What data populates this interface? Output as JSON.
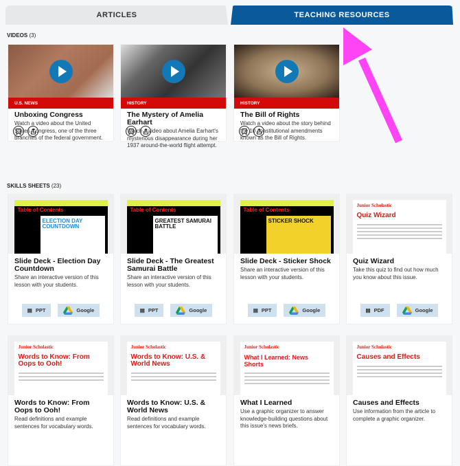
{
  "tabs": [
    {
      "label": "ARTICLES",
      "active": false
    },
    {
      "label": "TEACHING RESOURCES",
      "active": true
    }
  ],
  "videos": {
    "label": "VIDEOS",
    "count": "(3)",
    "items": [
      {
        "tag": "U.S. NEWS",
        "title": "Unboxing Congress",
        "desc": "Watch a video about the United States Congress, one of the three branches of the federal government."
      },
      {
        "tag": "HISTORY",
        "title": "The Mystery of Amelia Earhart",
        "desc": "Watch a video about Amelia Earhart's mysterious disappearance during her 1937 around-the-world flight attempt."
      },
      {
        "tag": "HISTORY",
        "title": "The Bill of Rights",
        "desc": "Watch a video about the story behind the 10 constitutional amendments known as the Bill of Rights."
      }
    ]
  },
  "skills": {
    "label": "SKILLS SHEETS",
    "count": "(23)",
    "items": [
      {
        "title": "Slide Deck - Election Day Countdown",
        "desc": "Share an interactive version of this lesson with your students.",
        "thumb_title": "Table of Contents",
        "thumb_headline": "ELECTION DAY COUNTDOWN",
        "buttons": [
          "PPT",
          "Google"
        ]
      },
      {
        "title": "Slide Deck - The Greatest Samurai Battle",
        "desc": "Share an interactive version of this lesson with your students.",
        "thumb_title": "Table of Contents",
        "thumb_headline": "GREATEST SAMURAI BATTLE",
        "buttons": [
          "PPT",
          "Google"
        ]
      },
      {
        "title": "Slide Deck - Sticker Shock",
        "desc": "Share an interactive version of this lesson with your students.",
        "thumb_title": "Table of Contents",
        "thumb_headline": "STICKER SHOCK",
        "buttons": [
          "PPT",
          "Google"
        ]
      },
      {
        "title": "Quiz Wizard",
        "desc": "Take this quiz to find out how much you know about this issue.",
        "thumb_brand": "Junior Scholastic",
        "thumb_title": "Quiz Wizard",
        "buttons": [
          "PDF",
          "Google"
        ]
      },
      {
        "title": "Words to Know: From Oops to Ooh!",
        "desc": "Read definitions and example sentences for vocabulary words.",
        "thumb_brand": "Junior Scholastic",
        "thumb_title": "Words to Know: From Oops to Ooh!"
      },
      {
        "title": "Words to Know: U.S. & World News",
        "desc": "Read definitions and example sentences for vocabulary words.",
        "thumb_brand": "Junior Scholastic",
        "thumb_title": "Words to Know: U.S. & World News"
      },
      {
        "title": "What I Learned",
        "desc": "Use a graphic organizer to answer knowledge-building questions about this issue's news briefs.",
        "thumb_brand": "Junior Scholastic",
        "thumb_title": "What I Learned: News Shorts"
      },
      {
        "title": "Causes and Effects",
        "desc": "Use information from the article to complete a graphic organizer.",
        "thumb_brand": "Junior Scholastic",
        "thumb_title": "Causes and Effects"
      }
    ]
  },
  "colors": {
    "tab_active": "#0a5a9b",
    "tag_red": "#d20a0a",
    "play_blue": "#1278b6",
    "annotation_arrow": "#ff44f5"
  }
}
